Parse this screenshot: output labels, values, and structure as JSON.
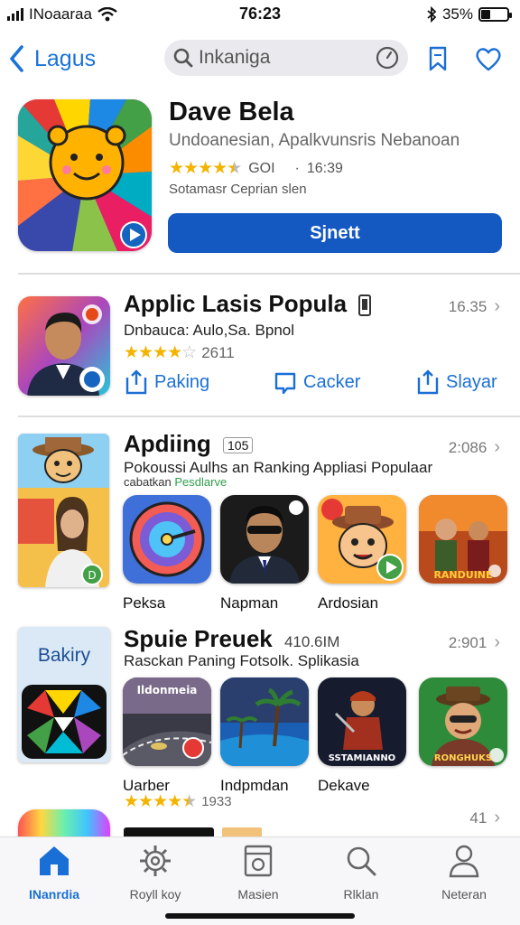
{
  "status": {
    "carrier": "INoaaraa",
    "time": "76:23",
    "battery": "35%",
    "battery_level": 0.35
  },
  "nav": {
    "back_label": "Lagus",
    "search_placeholder": "Inkaniga"
  },
  "featured": {
    "title": "Dave Bela",
    "subtitle": "Undoanesian, Apalkvunsris Nebanoan",
    "rating": "GOI",
    "separator": "·",
    "size": "16:39",
    "desc": "Sotamasr Ceprian slen",
    "get_label": "Sjnett",
    "stars": 4.5
  },
  "section1": {
    "title": "Applic Lasis Popula",
    "count": "16.35",
    "sub": "Dnbauca: Aulo,Sa. Bpnol",
    "rating_count": "2611",
    "stars": 4,
    "actions": [
      {
        "label": "Paking"
      },
      {
        "label": "Cacker"
      },
      {
        "label": "Slayar"
      }
    ]
  },
  "section2": {
    "title": "Apdiing",
    "badge": "105",
    "count": "2:086",
    "sub": "Pokoussi Aulhs an Ranking Appliasi Populaar",
    "sub2_prefix": "cabatkan",
    "sub2_highlight": "Pesdlarve",
    "cards": [
      {
        "label": "Peksa"
      },
      {
        "label": "Napman"
      },
      {
        "label": "Ardosian"
      },
      {
        "label": ""
      }
    ],
    "card4_text": "RANDUINE"
  },
  "section3": {
    "tile_label": "Bakiry",
    "title": "Spuie Preuek",
    "size": "410.6IM",
    "count": "2:901",
    "sub": "Rasckan Paning Fotsolk. Splikasia",
    "cards": [
      {
        "label": "Uarber",
        "text": "Ildonmeia"
      },
      {
        "label": "Indpmdan"
      },
      {
        "label": "Dekave",
        "text": "SSTAMIANNO"
      },
      {
        "label": "",
        "text": "RONGHUKS"
      }
    ],
    "rating_count": "1933",
    "stars": 4.5
  },
  "section4": {
    "count": "41"
  },
  "tabs": [
    {
      "label": "INanrdia",
      "icon": "home-icon",
      "active": true
    },
    {
      "label": "Royll koy",
      "icon": "gear-icon",
      "active": false
    },
    {
      "label": "Masien",
      "icon": "document-icon",
      "active": false
    },
    {
      "label": "Rlklan",
      "icon": "search-icon",
      "active": false
    },
    {
      "label": "Neteran",
      "icon": "person-icon",
      "active": false
    }
  ],
  "colors": {
    "accent": "#1a6fd6",
    "get_button": "#1458c2",
    "star": "#f3b400",
    "highlight_green": "#2e9e4a"
  }
}
